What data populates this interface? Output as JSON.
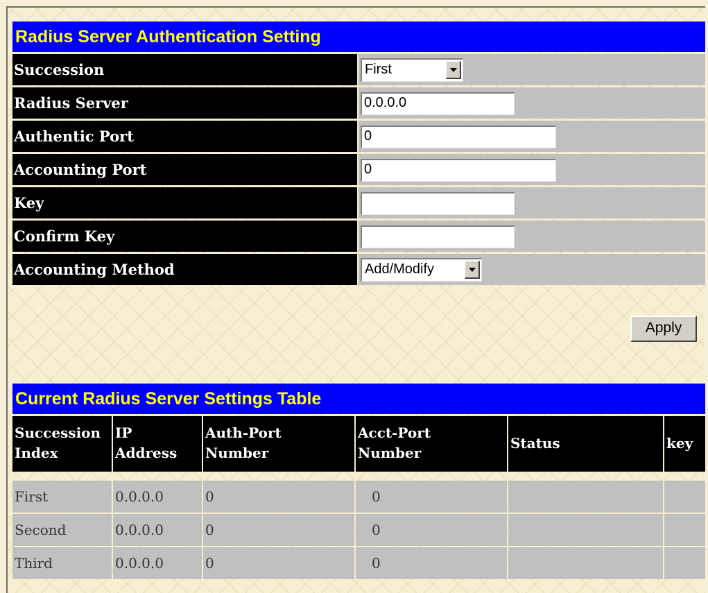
{
  "auth_header": "Radius Server Authentication Setting",
  "form": {
    "succession": {
      "label": "Succession",
      "value": "First"
    },
    "radius_server": {
      "label": "Radius Server",
      "value": "0.0.0.0"
    },
    "authentic_port": {
      "label": "Authentic Port",
      "value": "0"
    },
    "accounting_port": {
      "label": "Accounting Port",
      "value": "0"
    },
    "key": {
      "label": "Key",
      "value": ""
    },
    "confirm_key": {
      "label": "Confirm Key",
      "value": ""
    },
    "accounting_method": {
      "label": "Accounting Method",
      "value": "Add/Modify"
    }
  },
  "apply_label": "Apply",
  "table": {
    "title": "Current Radius Server Settings Table",
    "headers": {
      "succession_index_1": "Succession",
      "succession_index_2": "Index",
      "ip_address_1": "IP",
      "ip_address_2": "Address",
      "auth_port_1": "Auth-Port",
      "auth_port_2": "Number",
      "acct_port_1": "Acct-Port",
      "acct_port_2": "Number",
      "status": "Status",
      "key": "key"
    },
    "rows": [
      {
        "succession": "First",
        "ip": "0.0.0.0",
        "auth_port": "0",
        "acct_port": "0",
        "status": "",
        "key": ""
      },
      {
        "succession": "Second",
        "ip": "0.0.0.0",
        "auth_port": "0",
        "acct_port": "0",
        "status": "",
        "key": ""
      },
      {
        "succession": "Third",
        "ip": "0.0.0.0",
        "auth_port": "0",
        "acct_port": "0",
        "status": "",
        "key": ""
      }
    ]
  },
  "colors": {
    "header_bg": "#0000ff",
    "header_text": "#ffff00",
    "label_bg": "#000000",
    "value_bg": "#c0c0c0"
  }
}
